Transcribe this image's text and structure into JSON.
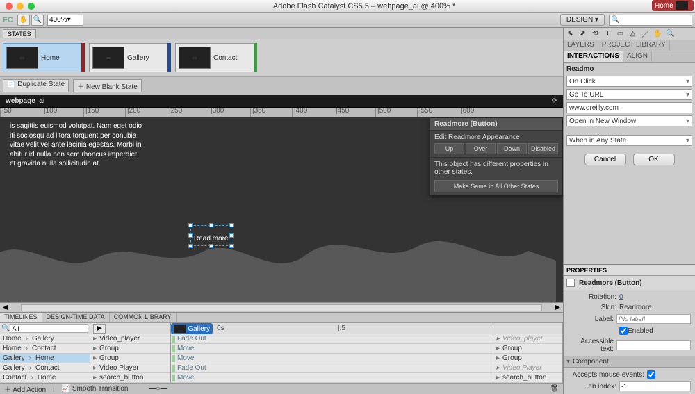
{
  "app": {
    "title": "Adobe Flash Catalyst CS5.5 – webpage_ai @ 400% *"
  },
  "toolbar": {
    "logo": "FC",
    "zoom": "400%",
    "workspace": "DESIGN",
    "search_placeholder": ""
  },
  "states": {
    "panel": "STATES",
    "items": [
      {
        "name": "Home",
        "color": "#9c1f1f",
        "sel": true
      },
      {
        "name": "Gallery",
        "color": "#1f4f9c",
        "sel": false
      },
      {
        "name": "Contact",
        "color": "#2fa23a",
        "sel": false
      }
    ],
    "dup": "Duplicate State",
    "blank": "New Blank State"
  },
  "document": {
    "tab": "webpage_ai"
  },
  "ruler": [
    "|50",
    "|100",
    "|150",
    "|200",
    "|250",
    "|300",
    "|350",
    "|400",
    "|450",
    "|500",
    "|550",
    "|600"
  ],
  "canvas": {
    "lines": [
      "is sagittis euismod volutpat. Nam eget odio",
      "iti sociosqu ad litora torquent per conubia",
      "vitae velit vel ante lacinia egestas. Morbi in",
      "abitur id nulla non sem rhoncus imperdiet",
      "et gravida nulla sollicitudin at."
    ],
    "readmore": "Read more"
  },
  "popup": {
    "title": "Readmore (Button)",
    "section": "Edit Readmore Appearance",
    "buttons": [
      "Up",
      "Over",
      "Down",
      "Disabled"
    ],
    "note": "This object has different properties in other states.",
    "make_same": "Make Same in All Other States"
  },
  "timelines": {
    "tabs": [
      "TIMELINES",
      "DESIGN-TIME DATA",
      "COMMON LIBRARY"
    ],
    "search": "All",
    "transitions": [
      {
        "from": "Home",
        "to": "Gallery",
        "sel": false
      },
      {
        "from": "Home",
        "to": "Contact",
        "sel": false
      },
      {
        "from": "Gallery",
        "to": "Home",
        "sel": true
      },
      {
        "from": "Gallery",
        "to": "Contact",
        "sel": false
      },
      {
        "from": "Contact",
        "to": "Home",
        "sel": false
      }
    ],
    "from_state": "Gallery",
    "to_state": "Home",
    "layers_from": [
      {
        "n": "Video_player",
        "dim": false
      },
      {
        "n": "Group",
        "dim": false
      },
      {
        "n": "Group",
        "dim": false
      },
      {
        "n": "Video Player",
        "dim": false
      },
      {
        "n": "search_button",
        "dim": false
      }
    ],
    "actions": [
      "Fade Out",
      "Move",
      "Move",
      "Fade Out",
      "Move"
    ],
    "layers_to": [
      {
        "n": "Video_player",
        "dim": true
      },
      {
        "n": "Group",
        "dim": false
      },
      {
        "n": "Group",
        "dim": false
      },
      {
        "n": "Video Player",
        "dim": true
      },
      {
        "n": "search_button",
        "dim": false
      }
    ],
    "foot": {
      "add": "Add Action",
      "smooth": "Smooth Transition"
    }
  },
  "right": {
    "tabs1": [
      "LAYERS",
      "PROJECT LIBRARY"
    ],
    "tabs2": [
      "INTERACTIONS",
      "ALIGN"
    ],
    "int_title": "Readmo",
    "fields": {
      "event": "On Click",
      "action": "Go To URL",
      "url": "www.oreilly.com",
      "target": "Open in New Window",
      "condition": "When in Any State"
    },
    "cancel": "Cancel",
    "ok": "OK"
  },
  "props": {
    "tab": "PROPERTIES",
    "title": "Readmore (Button)",
    "rotation_lab": "Rotation:",
    "rotation_val": "0",
    "skin_lab": "Skin:",
    "skin_val": "Readmore",
    "label_lab": "Label:",
    "label_ph": "[No label]",
    "enabled": "Enabled",
    "access_lab": "Accessible text:",
    "section": "Component",
    "mouse_lab": "Accepts mouse events:",
    "tab_lab": "Tab index:",
    "tab_val": "-1"
  }
}
